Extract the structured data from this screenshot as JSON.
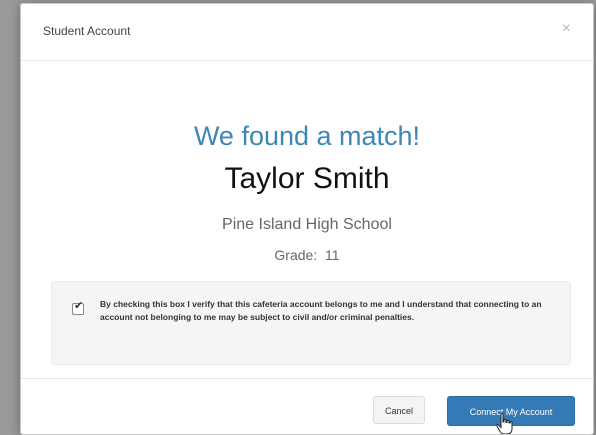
{
  "modal": {
    "title": "Student Account",
    "close_symbol": "×"
  },
  "match": {
    "heading": "We found a match!",
    "student_name": "Taylor Smith",
    "school": "Pine Island High School",
    "grade_label": "Grade:",
    "grade_value": "11"
  },
  "consent": {
    "checked": true,
    "text": "By checking this box I verify that this cafeteria account belongs to me and I understand that connecting to an account not belonging to me may be subject to civil and/or criminal penalties."
  },
  "footer": {
    "cancel_label": "Cancel",
    "connect_label": "Connect My Account"
  },
  "colors": {
    "heading_blue": "#3d87b5",
    "primary_button": "#337ab7"
  },
  "icons": {
    "checkbox": "check-icon",
    "close": "close-icon",
    "cursor": "hand-pointer-icon"
  }
}
